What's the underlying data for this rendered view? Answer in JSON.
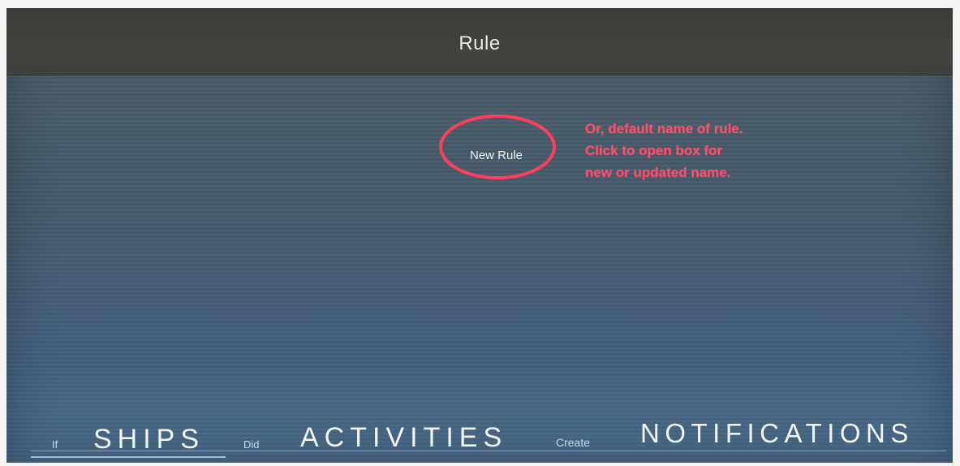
{
  "window": {
    "title": "Rule"
  },
  "rule": {
    "name": "New Rule"
  },
  "annotation": {
    "color": "#ff4d6e",
    "lines": [
      "Or, default name of rule.",
      "Click to open box for",
      "new or updated name."
    ]
  },
  "tabs": {
    "if_label": "If",
    "ships_label": "SHIPS",
    "did_label": "Did",
    "activities_label": "ACTIVITIES",
    "create_label": "Create",
    "notifications_label": "NOTIFICATIONS"
  }
}
